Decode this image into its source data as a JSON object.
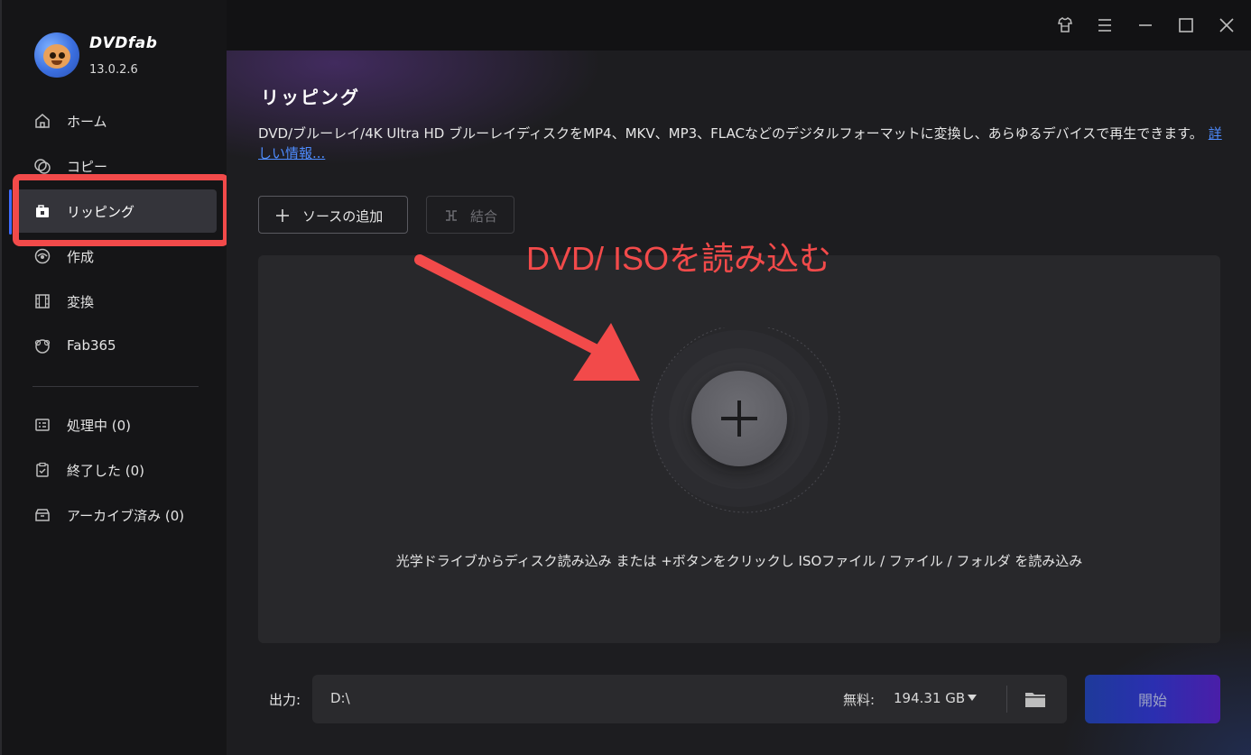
{
  "app": {
    "name": "DVDfab",
    "version": "13.0.2.6"
  },
  "sidebar": {
    "items": [
      {
        "label": "ホーム",
        "icon": "home-icon"
      },
      {
        "label": "コピー",
        "icon": "copy-disc-icon"
      },
      {
        "label": "リッピング",
        "icon": "ripper-icon",
        "active": true
      },
      {
        "label": "作成",
        "icon": "creator-disc-icon"
      },
      {
        "label": "変換",
        "icon": "film-icon"
      },
      {
        "label": "Fab365",
        "icon": "fab365-icon"
      }
    ],
    "queue": [
      {
        "label": "処理中 (0)",
        "icon": "task-list-icon"
      },
      {
        "label": "終了した (0)",
        "icon": "clipboard-check-icon"
      },
      {
        "label": "アーカイブ済み (0)",
        "icon": "archive-icon"
      }
    ]
  },
  "titlebar": {
    "icons": [
      "skin-shirt-icon",
      "menu-icon",
      "minimize-icon",
      "maximize-icon",
      "close-icon"
    ]
  },
  "main": {
    "title": "リッピング",
    "description": "DVD/ブルーレイ/4K Ultra HD ブルーレイディスクをMP4、MKV、MP3、FLACなどのデジタルフォーマットに変換し、あらゆるデバイスで再生できます。",
    "more_link": "詳しい情報...",
    "add_source_label": "ソースの追加",
    "merge_label": "結合",
    "annotation": "DVD/ ISOを読み込む",
    "drop_hint": "光学ドライブからディスク読み込み または +ボタンをクリックし ISOファイル / ファイル / フォルダ を読み込み"
  },
  "output": {
    "label": "出力:",
    "path": "D:\\",
    "free_label": "無料:",
    "free_value": "194.31 GB",
    "start_label": "開始"
  },
  "colors": {
    "annotation": "#f24a4a",
    "link": "#4e8cff",
    "active_bar": "#3d6bff"
  }
}
